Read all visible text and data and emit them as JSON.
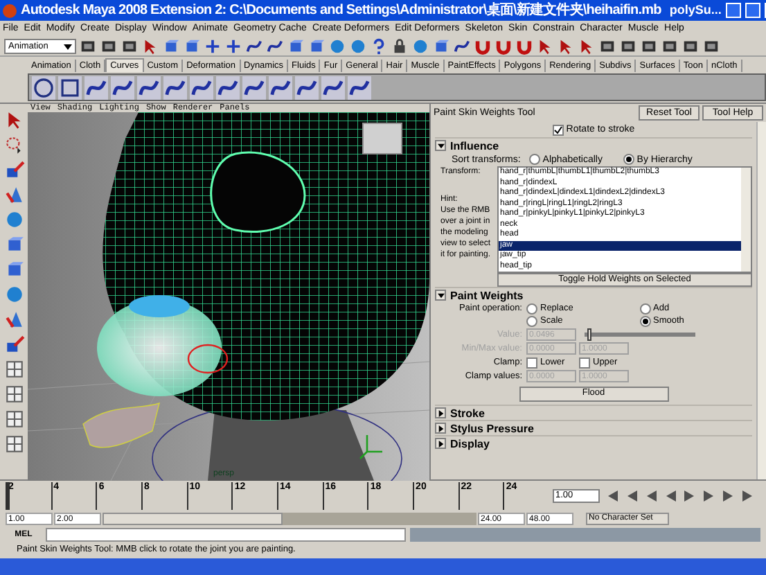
{
  "window": {
    "title": "Autodesk Maya 2008 Extension 2: C:\\Documents and Settings\\Administrator\\桌面\\新建文件夹\\heihaifin.mb",
    "title_right": "polySu..."
  },
  "menu_bar": [
    "File",
    "Edit",
    "Modify",
    "Create",
    "Display",
    "Window",
    "Animate",
    "Geometry Cache",
    "Create Deformers",
    "Edit Deformers",
    "Skeleton",
    "Skin",
    "Constrain",
    "Character",
    "Muscle",
    "Help"
  ],
  "status_line": {
    "mode": "Animation"
  },
  "shelf": {
    "tabs": [
      {
        "label": "Animation",
        "selected": false
      },
      {
        "label": "Cloth",
        "selected": false
      },
      {
        "label": "Curves",
        "selected": true
      },
      {
        "label": "Custom",
        "selected": false
      },
      {
        "label": "Deformation",
        "selected": false
      },
      {
        "label": "Dynamics",
        "selected": false
      },
      {
        "label": "Fluids",
        "selected": false
      },
      {
        "label": "Fur",
        "selected": false
      },
      {
        "label": "General",
        "selected": false
      },
      {
        "label": "Hair",
        "selected": false
      },
      {
        "label": "Muscle",
        "selected": false
      },
      {
        "label": "PaintEffects",
        "selected": false
      },
      {
        "label": "Polygons",
        "selected": false
      },
      {
        "label": "Rendering",
        "selected": false
      },
      {
        "label": "Subdivs",
        "selected": false
      },
      {
        "label": "Surfaces",
        "selected": false
      },
      {
        "label": "Toon",
        "selected": false
      },
      {
        "label": "nCloth",
        "selected": false
      }
    ]
  },
  "viewport": {
    "menus": [
      "View",
      "Shading",
      "Lighting",
      "Show",
      "Renderer",
      "Panels"
    ],
    "camera_label": "persp"
  },
  "tool_settings": {
    "title": "Paint Skin Weights Tool",
    "buttons": [
      "Reset Tool",
      "Tool Help"
    ],
    "rotate_to_stroke": {
      "label": "Rotate to stroke",
      "checked": true
    },
    "influence": {
      "title": "Influence",
      "expanded": true,
      "sort_label": "Sort transforms:",
      "sort_options": [
        {
          "label": "Alphabetically",
          "selected": false
        },
        {
          "label": "By Hierarchy",
          "selected": true
        }
      ],
      "transform_label": "Transform:",
      "hint_title": "Hint:",
      "hint": "Use the RMB over a joint in the modeling view to select it for painting.",
      "transforms": [
        {
          "label": "hand_r|thumbL|thumbL1|thumbL2|thumbL3",
          "selected": false
        },
        {
          "label": "hand_r|dindexL",
          "selected": false
        },
        {
          "label": "hand_r|dindexL|dindexL1|dindexL2|dindexL3",
          "selected": false
        },
        {
          "label": "hand_r|ringL|ringL1|ringL2|ringL3",
          "selected": false
        },
        {
          "label": "hand_r|pinkyL|pinkyL1|pinkyL2|pinkyL3",
          "selected": false
        },
        {
          "label": "neck",
          "selected": false
        },
        {
          "label": "head",
          "selected": false
        },
        {
          "label": "jaw",
          "selected": true
        },
        {
          "label": "jaw_tip",
          "selected": false
        },
        {
          "label": "head_tip",
          "selected": false
        }
      ],
      "hold_button": "Toggle Hold Weights on Selected"
    },
    "paint_weights": {
      "title": "Paint Weights",
      "expanded": true,
      "operation_label": "Paint operation:",
      "operations": [
        {
          "label": "Replace",
          "selected": false
        },
        {
          "label": "Add",
          "selected": false
        },
        {
          "label": "Scale",
          "selected": false
        },
        {
          "label": "Smooth",
          "selected": true
        }
      ],
      "value_label": "Value:",
      "value": "0.0496",
      "level": 0.03,
      "minmax_label": "Min/Max value:",
      "min": "0.0000",
      "max": "1.0000",
      "clamp_label": "Clamp:",
      "clamps": [
        {
          "label": "Lower",
          "checked": false
        },
        {
          "label": "Upper",
          "checked": false
        }
      ],
      "clamp_values_label": "Clamp values:",
      "clamp_min": "0.0000",
      "clamp_max": "1.0000",
      "flood_button": "Flood"
    },
    "collapsed_sections": [
      {
        "title": "Stroke",
        "expanded": false
      },
      {
        "title": "Stylus Pressure",
        "expanded": false
      },
      {
        "title": "Display",
        "expanded": false
      }
    ]
  },
  "time_slider": {
    "level": 0,
    "ticks": [
      "2",
      "4",
      "6",
      "8",
      "10",
      "12",
      "14",
      "16",
      "18",
      "20",
      "22",
      "24"
    ],
    "current_time": "1.00"
  },
  "range_slider": {
    "level": 0.48,
    "start": "1.00",
    "range_start": "2.00",
    "range_end": "24.00",
    "end": "48.00",
    "character_set": "No Character Set"
  },
  "command_line": {
    "label": "MEL"
  },
  "help_line": "Paint Skin Weights Tool: MMB click to rotate the joint you are painting."
}
